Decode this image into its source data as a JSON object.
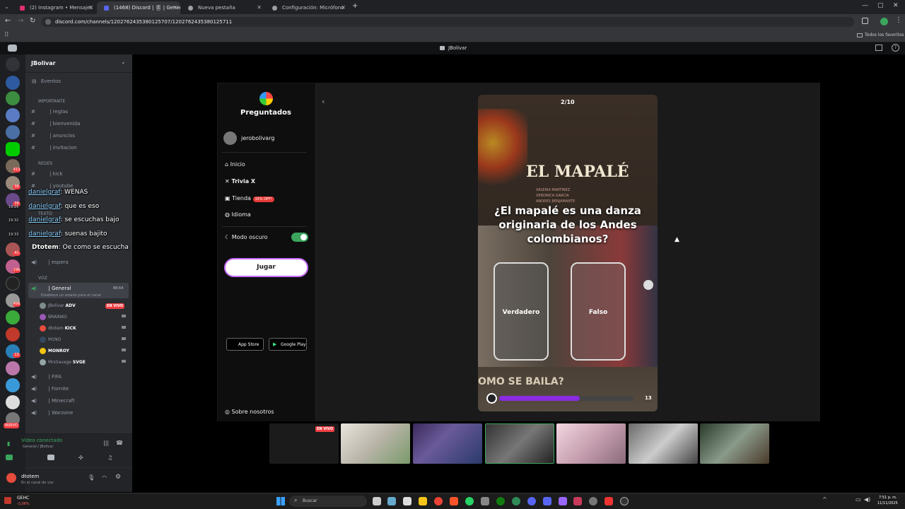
{
  "browser": {
    "tabs": [
      {
        "label": "(2) Instagram • Mensajes",
        "icon": "instagram-icon",
        "color": "#e1306c"
      },
      {
        "label": "(1468) Discord | 🎚 | General",
        "icon": "discord-icon",
        "color": "#5865f2"
      },
      {
        "label": "Nueva pestaña",
        "icon": "chrome-icon",
        "color": "#9aa0a6"
      },
      {
        "label": "Configuración: Micrófono",
        "icon": "gear-icon",
        "color": "#9aa0a6"
      }
    ],
    "url": "discord.com/channels/1202762435380125707/1202762435380125711",
    "bookmarks_label": "Todos los favoritos"
  },
  "stream_title": "JBolivar",
  "discord": {
    "server_name": "JBolivar",
    "events_label": "Eventos",
    "categories": {
      "importante": "IMPORTANTE",
      "redes": "REDES",
      "texto": "TEXTO",
      "voz": "VOZ"
    },
    "channels": {
      "reglas": "| reglas",
      "bienvenida": "| bienvenida",
      "anuncios": "| anuncios",
      "invitacion": "| invitacion",
      "kick": "| kick",
      "youtube": "| youtube",
      "espera": "| espera",
      "general": "| General",
      "general_count": "88:64",
      "general_status": "Establece un estado para el canal",
      "fifa": "| FIFA",
      "fornite": "| Fornite",
      "minecraft": "| Minecraft",
      "warzone": "| Warzone"
    },
    "voice_users": [
      {
        "name": "JBolivar",
        "tag": "ADV",
        "live": "EN VIVO",
        "color": "#7f8c8d"
      },
      {
        "name": "BRAINKO",
        "tag": "",
        "live": "",
        "color": "#9b59b6"
      },
      {
        "name": "dtotem",
        "tag": "KICK",
        "live": "",
        "color": "#e74c3c"
      },
      {
        "name": "M1NO",
        "tag": "",
        "live": "",
        "color": "#34495e"
      },
      {
        "name": "MONROY",
        "tag": "",
        "live": "",
        "color": "#f1c40f"
      },
      {
        "name": "MrsSavage",
        "tag": "SVGE",
        "live": "",
        "color": "#95a5a6"
      }
    ],
    "guild_badges": [
      "413",
      "38",
      "39",
      "41",
      "196",
      "498",
      "13"
    ],
    "nuevo_label": "NUEVO",
    "voice_status": {
      "title": "Video conectado",
      "subtitle": "General / JBolivar"
    },
    "user": {
      "name": "dtotem",
      "status": "En el canal de voz"
    }
  },
  "overlay_chat": [
    {
      "time": "",
      "name": "danielgraf",
      "text": ": WENAS"
    },
    {
      "time": "19:26",
      "name": "danielgraf",
      "text": ": que es eso"
    },
    {
      "time": "19:32",
      "name": "danielgraf",
      "text": ": se escuchas bajo"
    },
    {
      "time": "19:33",
      "name": "danielgraf",
      "text": ": suenas bajito"
    },
    {
      "time": "",
      "name": "Dtotem",
      "text": ": Oe como se escucha"
    }
  ],
  "preguntados": {
    "brand": "Preguntados",
    "username": "jerobolivarg",
    "menu": {
      "inicio": "Inicio",
      "trivia": "Trivia X",
      "tienda": "Tienda",
      "tienda_badge": "15% OFF!",
      "idioma": "Idioma",
      "modo_oscuro": "Modo oscuro",
      "jugar": "Jugar",
      "app_store": "App Store",
      "google_play": "Google Play",
      "sobre": "Sobre nosotros"
    },
    "quiz": {
      "progress": "2/10",
      "bg_title": "EL MAPALÉ",
      "bg_authors": [
        "VALERIA MARTINEZ",
        "VERONICA GARCIA",
        "ANDRES BENJAMANTE"
      ],
      "question": "¿El mapalé es una danza originaria de los Andes colombianos?",
      "answers": [
        "Verdadero",
        "Falso"
      ],
      "bg_bottom": "OMO SE BAILA?",
      "timer": "13",
      "timer_fraction": 0.6
    }
  },
  "thumbnail_live": "EN VIVO",
  "taskbar": {
    "weather_temp": "GEHC",
    "weather_sub": "-3,06%",
    "search": "Buscar",
    "time": "7:51 p. m.",
    "date": "11/11/2025"
  },
  "colors": {
    "accent": "#5865f2",
    "live": "#f23f43",
    "toggle": "#3ba55d",
    "timer_bar": "#8a2be2"
  }
}
